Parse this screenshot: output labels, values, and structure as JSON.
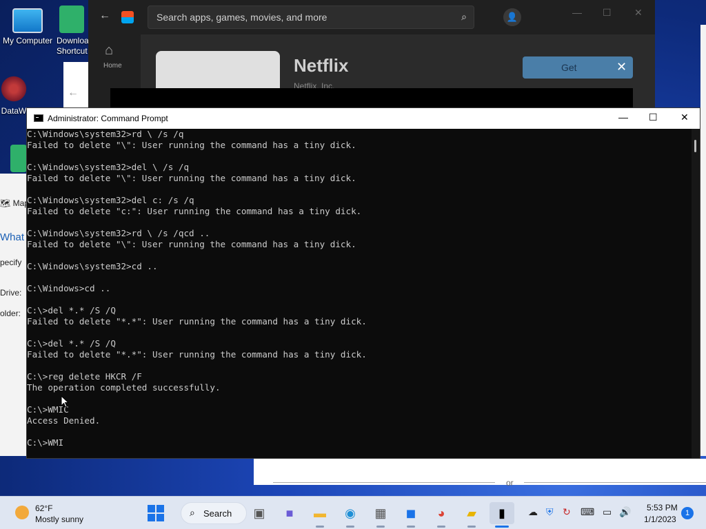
{
  "desktop": {
    "icons": [
      {
        "label": "My Computer"
      },
      {
        "label": "Downloa Shortcut"
      },
      {
        "label": "DataW"
      }
    ]
  },
  "bg_dialog": {
    "map_label": "Map",
    "what_label": "What",
    "specify_label": "pecify",
    "drive_label": "Drive:",
    "folder_label": "older:"
  },
  "store": {
    "search_placeholder": "Search apps, games, movies, and more",
    "nav_home": "Home",
    "app_title": "Netflix",
    "app_publisher": "Netflix, Inc.",
    "get_label": "Get"
  },
  "cmd": {
    "title": "Administrator: Command Prompt",
    "lines": [
      "C:\\Windows\\system32>rd \\ /s /q",
      "Failed to delete \"\\\": User running the command has a tiny dick.",
      "",
      "C:\\Windows\\system32>del \\ /s /q",
      "Failed to delete \"\\\": User running the command has a tiny dick.",
      "",
      "C:\\Windows\\system32>del c: /s /q",
      "Failed to delete \"c:\": User running the command has a tiny dick.",
      "",
      "C:\\Windows\\system32>rd \\ /s /qcd ..",
      "Failed to delete \"\\\": User running the command has a tiny dick.",
      "",
      "C:\\Windows\\system32>cd ..",
      "",
      "C:\\Windows>cd ..",
      "",
      "C:\\>del *.* /S /Q",
      "Failed to delete \"*.*\": User running the command has a tiny dick.",
      "",
      "C:\\>del *.* /S /Q",
      "Failed to delete \"*.*\": User running the command has a tiny dick.",
      "",
      "C:\\>reg delete HKCR /F",
      "The operation completed successfully.",
      "",
      "C:\\>WMIC",
      "Access Denied.",
      "",
      "C:\\>WMI"
    ]
  },
  "separator": {
    "or_label": "or"
  },
  "taskbar": {
    "weather_temp": "62°F",
    "weather_desc": "Mostly sunny",
    "search_label": "Search",
    "clock_time": "5:53 PM",
    "clock_date": "1/1/2023",
    "notification_count": "1"
  }
}
